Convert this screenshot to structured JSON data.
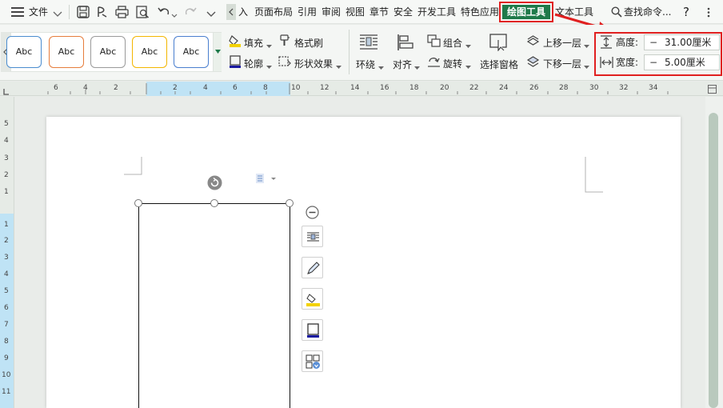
{
  "menubar": {
    "file_label": "文件",
    "tabs": [
      "载入",
      "页面布局",
      "引用",
      "审阅",
      "视图",
      "章节",
      "安全",
      "开发工具",
      "特色应用"
    ],
    "first_tab_visible": "入",
    "active_tab": "绘图工具",
    "text_tools_tab": "文本工具",
    "search_label": "查找命令...",
    "help_label": "?"
  },
  "ribbon": {
    "style_gallery": {
      "samples": [
        {
          "label": "Abc",
          "border": "#4a8ccf"
        },
        {
          "label": "Abc",
          "border": "#e67d3c"
        },
        {
          "label": "Abc",
          "border": "#9a9a9a"
        },
        {
          "label": "Abc",
          "border": "#f3b600"
        },
        {
          "label": "Abc",
          "border": "#4a7fcf"
        }
      ]
    },
    "fill_label": "填充",
    "format_painter_label": "格式刷",
    "outline_label": "轮廓",
    "shape_effects_label": "形状效果",
    "wrap_label": "环绕",
    "align_label": "对齐",
    "group_label": "组合",
    "rotate_label": "旋转",
    "selection_pane_label": "选择窗格",
    "bring_forward_label": "上移一层",
    "send_backward_label": "下移一层",
    "height_label": "高度:",
    "height_value": "31.00厘米",
    "width_label": "宽度:",
    "width_value": "5.00厘米",
    "minus": "−"
  },
  "ruler": {
    "h_labels": [
      "6",
      "4",
      "2",
      "",
      "2",
      "4",
      "6",
      "8",
      "10",
      "12",
      "14",
      "16",
      "18",
      "20",
      "22",
      "24",
      "26",
      "28",
      "30",
      "32",
      "34"
    ],
    "v_labels": [
      "5",
      "4",
      "3",
      "2",
      "1",
      "",
      "1",
      "2",
      "3",
      "4",
      "5",
      "6",
      "7",
      "8",
      "9",
      "10",
      "11"
    ]
  },
  "colors": {
    "accent_green": "#1f7a4a",
    "highlight_red": "#e02020",
    "ruler_active": "#bfe3f5"
  },
  "annotation_arrow_icon": "red-arrow-icon"
}
